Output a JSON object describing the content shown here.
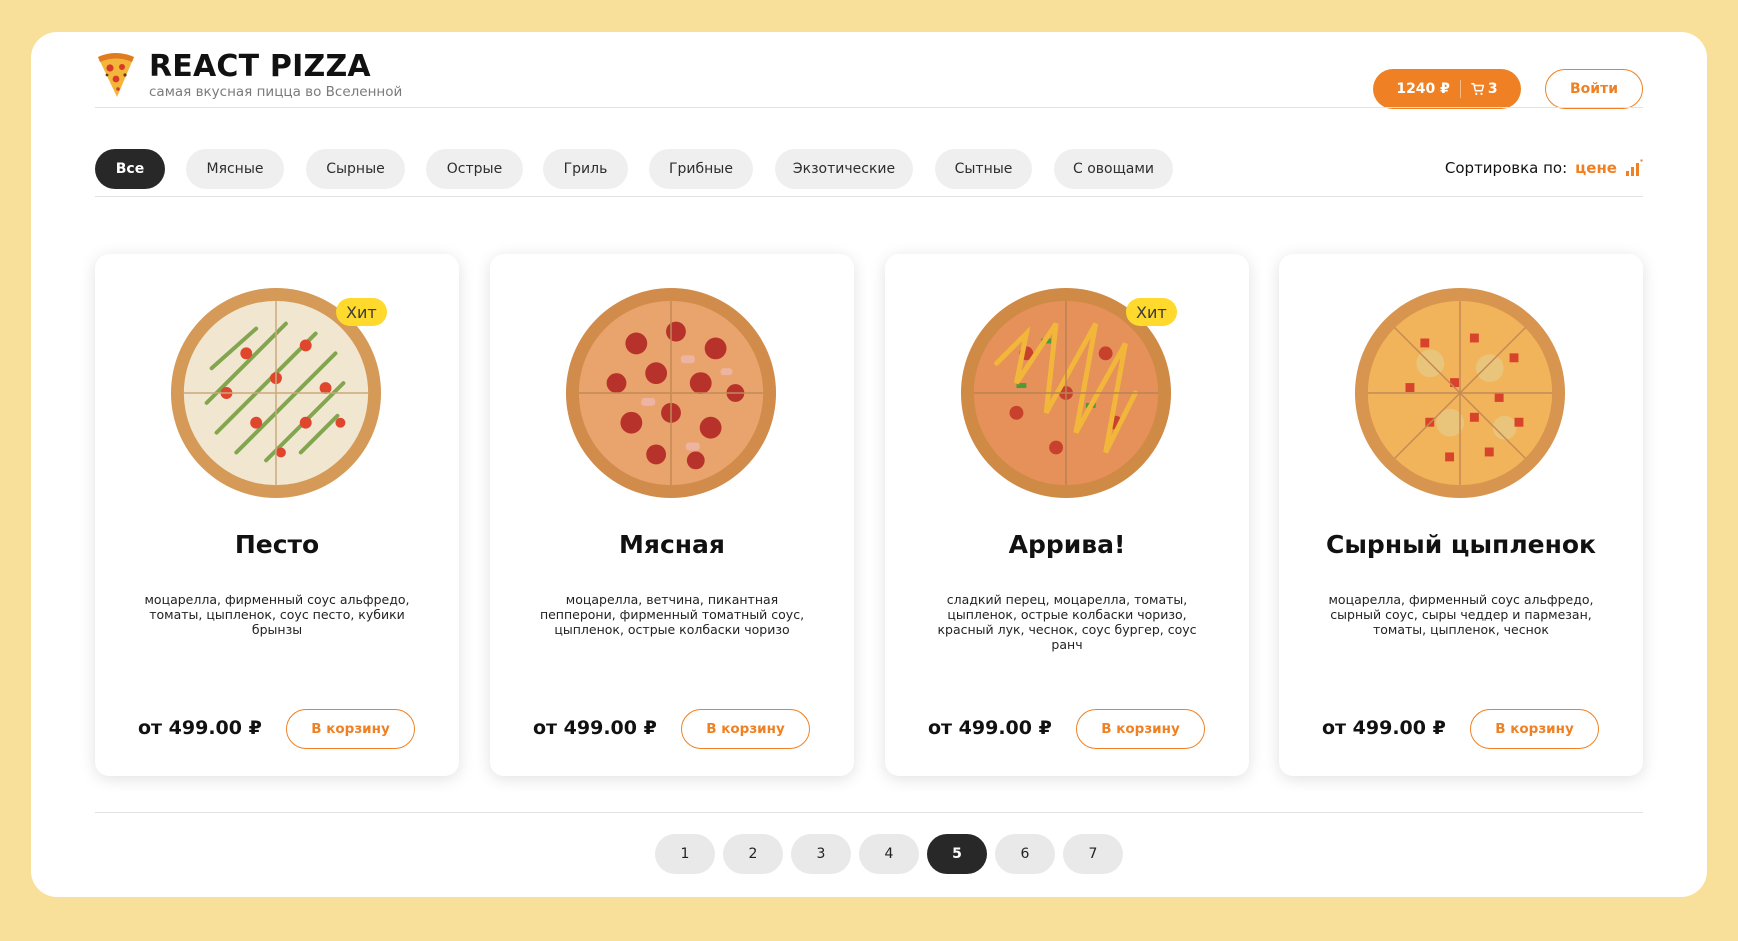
{
  "header": {
    "title": "REACT PIZZA",
    "subtitle": "самая вкусная пицца во Вселенной",
    "cart_total": "1240 ₽",
    "cart_count": "3",
    "login_label": "Войти"
  },
  "categories": {
    "items": [
      "Все",
      "Мясные",
      "Сырные",
      "Острые",
      "Гриль",
      "Грибные",
      "Экзотические",
      "Сытные",
      "С овощами"
    ],
    "active": "Все"
  },
  "sort": {
    "label": "Сортировка по:",
    "value": "цене"
  },
  "pizzas": [
    {
      "title": "Песто",
      "description": "моцарелла, фирменный соус альфредо, томаты, цыпленок, соус песто, кубики брынзы",
      "price": "от 499.00 ₽",
      "button": "В корзину",
      "badge": "Хит"
    },
    {
      "title": "Мясная",
      "description": "моцарелла, ветчина, пикантная пепперони, фирменный томатный соус, цыпленок, острые колбаски чоризо",
      "price": "от 499.00 ₽",
      "button": "В корзину",
      "badge": ""
    },
    {
      "title": "Аррива!",
      "description": "сладкий перец, моцарелла, томаты, цыпленок, острые колбаски чоризо, красный лук, чеснок, соус бургер, соус ранч",
      "price": "от 499.00 ₽",
      "button": "В корзину",
      "badge": "Хит"
    },
    {
      "title": "Сырный цыпленок",
      "description": "моцарелла, фирменный соус альфредо, сырный соус, сыры чеддер и пармезан, томаты, цыпленок, чеснок",
      "price": "от 499.00 ₽",
      "button": "В корзину",
      "badge": ""
    }
  ],
  "pagination": {
    "pages": [
      "1",
      "2",
      "3",
      "4",
      "5",
      "6",
      "7"
    ],
    "active": "5"
  },
  "colors": {
    "page_bg": "#f9e09a",
    "accent": "#ef8124",
    "dark": "#282828",
    "badge": "#ffd92b"
  },
  "icons": {
    "logo": "pizza-slice-icon",
    "cart": "cart-icon",
    "sort": "sort-bars-icon"
  }
}
